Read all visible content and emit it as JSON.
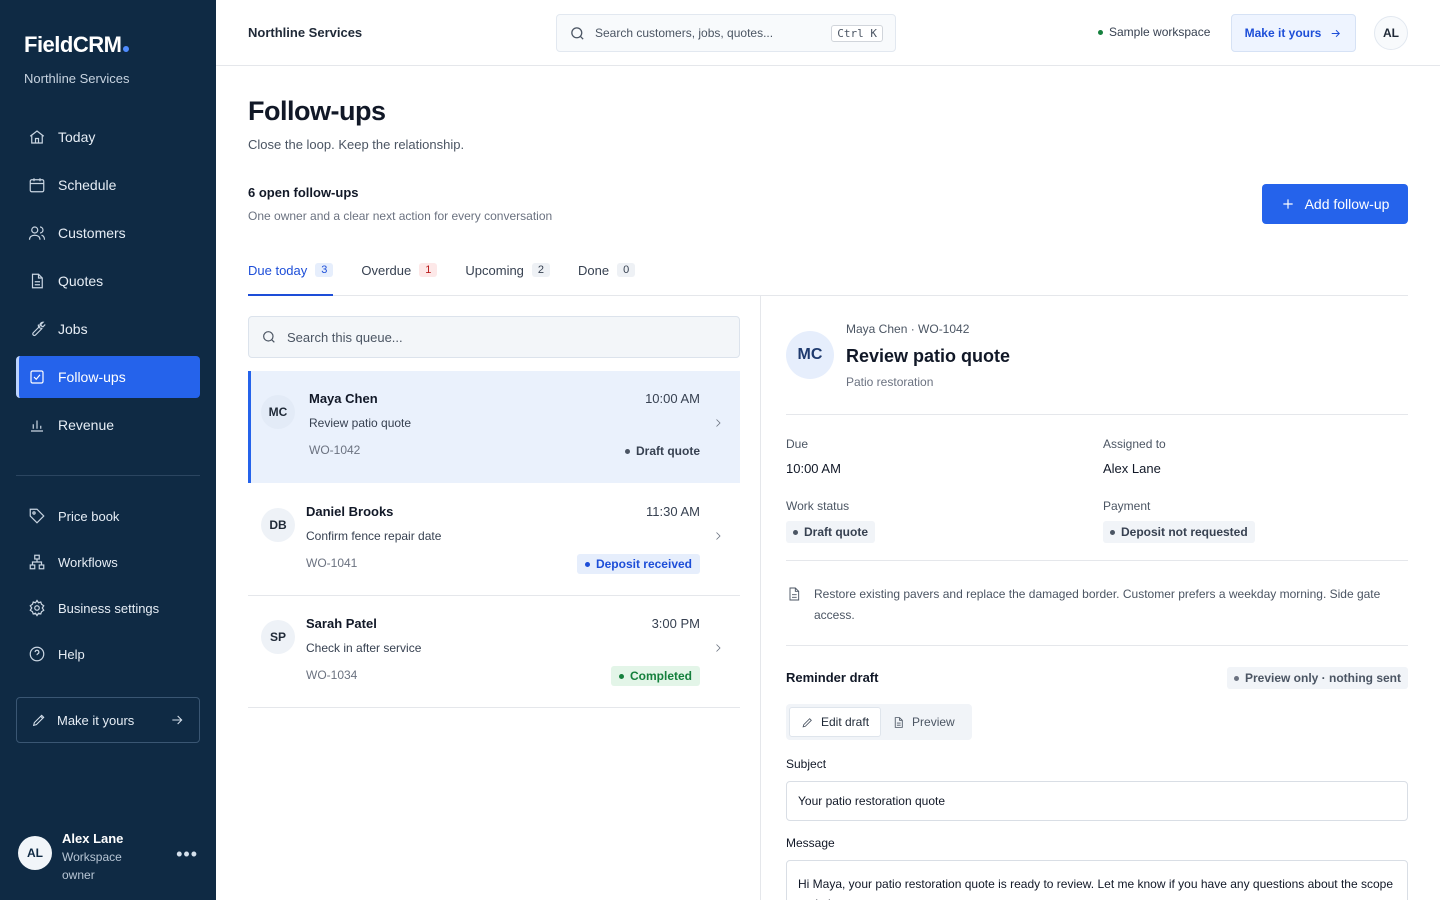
{
  "sidebar": {
    "brand": "FieldCRM",
    "org": "Northline Services",
    "nav": [
      {
        "label": "Today"
      },
      {
        "label": "Schedule"
      },
      {
        "label": "Customers"
      },
      {
        "label": "Quotes"
      },
      {
        "label": "Jobs"
      },
      {
        "label": "Follow-ups"
      },
      {
        "label": "Revenue"
      }
    ],
    "nav2": [
      {
        "label": "Price book"
      },
      {
        "label": "Workflows"
      },
      {
        "label": "Business settings"
      },
      {
        "label": "Help"
      }
    ],
    "make_yours": "Make it yours",
    "user": {
      "initials": "AL",
      "name": "Alex Lane",
      "role": "Workspace owner"
    }
  },
  "topbar": {
    "org": "Northline Services",
    "search_placeholder": "Search customers, jobs, quotes...",
    "shortcut": "Ctrl K",
    "sample": "Sample workspace",
    "make_yours": "Make it yours",
    "avatar": "AL"
  },
  "header": {
    "title": "Follow-ups",
    "subtitle": "Close the loop. Keep the relationship.",
    "open_count": "6 open follow-ups",
    "open_sub": "One owner and a clear next action for every conversation",
    "add_label": "Add follow-up"
  },
  "tabs": [
    {
      "label": "Due today",
      "count": "3"
    },
    {
      "label": "Overdue",
      "count": "1"
    },
    {
      "label": "Upcoming",
      "count": "2"
    },
    {
      "label": "Done",
      "count": "0"
    }
  ],
  "queue": {
    "search_placeholder": "Search this queue...",
    "items": [
      {
        "initials": "MC",
        "name": "Maya Chen",
        "time": "10:00 AM",
        "desc": "Review patio quote",
        "wo": "WO-1042",
        "status": "Draft quote"
      },
      {
        "initials": "DB",
        "name": "Daniel Brooks",
        "time": "11:30 AM",
        "desc": "Confirm fence repair date",
        "wo": "WO-1041",
        "status": "Deposit received"
      },
      {
        "initials": "SP",
        "name": "Sarah Patel",
        "time": "3:00 PM",
        "desc": "Check in after service",
        "wo": "WO-1034",
        "status": "Completed"
      }
    ]
  },
  "detail": {
    "initials": "MC",
    "meta": "Maya Chen · WO-1042",
    "title": "Review patio quote",
    "sub": "Patio restoration",
    "due_label": "Due",
    "due_value": "10:00 AM",
    "assigned_label": "Assigned to",
    "assigned_value": "Alex Lane",
    "work_label": "Work status",
    "work_value": "Draft quote",
    "payment_label": "Payment",
    "payment_value": "Deposit not requested",
    "note": "Restore existing pavers and replace the damaged border. Customer prefers a weekday morning. Side gate access.",
    "reminder_title": "Reminder draft",
    "preview_only": "Preview only · nothing sent",
    "edit_label": "Edit draft",
    "preview_label": "Preview",
    "subject_label": "Subject",
    "subject_value": "Your patio restoration quote",
    "message_label": "Message",
    "message_value": "Hi Maya, your patio restoration quote is ready to review. Let me know if you have any questions about the scope or timing."
  },
  "colors": {
    "sidebar_bg": "#0f2a44",
    "accent": "#2563eb",
    "success": "#15803d",
    "danger": "#b91c1c"
  }
}
